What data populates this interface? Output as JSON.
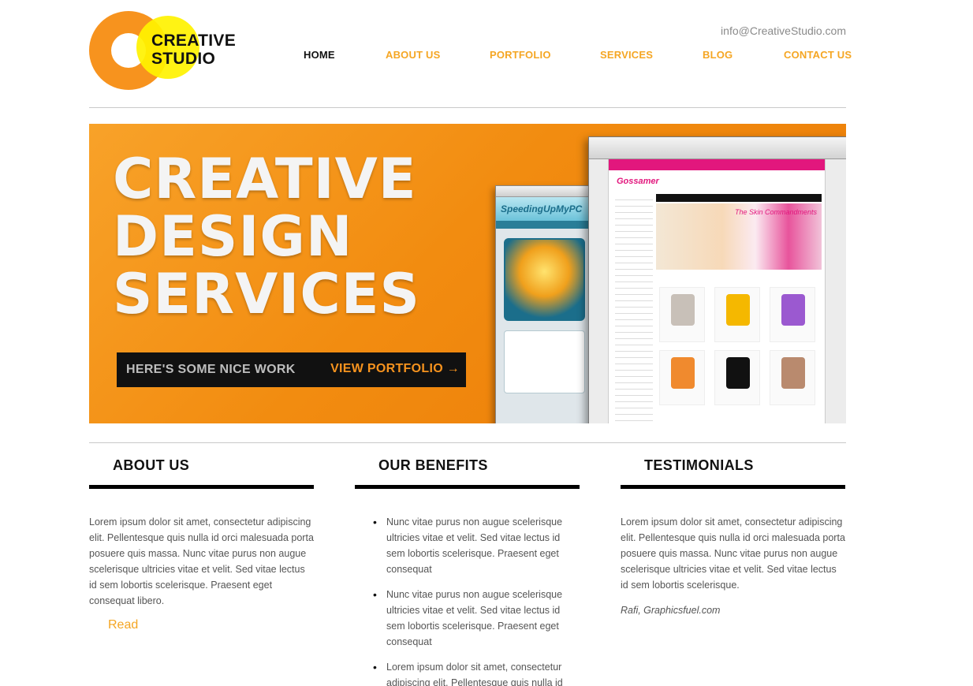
{
  "header": {
    "logo_text_line1": "CREATIVE",
    "logo_text_line2": "STUDIO",
    "email": "info@CreativeStudio.com"
  },
  "nav": {
    "items": [
      {
        "label": "HOME",
        "active": true
      },
      {
        "label": "ABOUT US",
        "active": false
      },
      {
        "label": "PORTFOLIO",
        "active": false
      },
      {
        "label": "SERVICES",
        "active": false
      },
      {
        "label": "BLOG",
        "active": false
      },
      {
        "label": "CONTACT US",
        "active": false
      }
    ]
  },
  "hero": {
    "headline": [
      "CREATIVE",
      "DESIGN",
      "SERVICES"
    ],
    "tagline": "HERE'S SOME NICE WORK",
    "cta_label": "VIEW PORTFOLIO →",
    "mock_small_title": "SpeedingUpMyPC",
    "mock_big_brand": "Gossamer",
    "mock_big_banner": "The Skin Commandments"
  },
  "columns": {
    "about": {
      "title": "ABOUT US",
      "body": "Lorem ipsum dolor sit amet, consectetur adipiscing elit. Pellentesque quis nulla id orci malesuada porta posuere quis massa. Nunc vitae purus non augue scelerisque ultricies vitae et velit. Sed vitae lectus id sem lobortis scelerisque. Praesent eget consequat libero.",
      "read_label": "Read"
    },
    "benefits": {
      "title": "OUR BENEFITS",
      "items": [
        "Nunc vitae purus non augue scelerisque ultricies vitae et velit. Sed vitae lectus id sem lobortis scelerisque. Praesent eget consequat",
        "Nunc vitae purus non augue scelerisque ultricies vitae et velit. Sed vitae lectus id sem lobortis scelerisque. Praesent eget consequat",
        "Lorem ipsum dolor sit amet, consectetur adipiscing elit. Pellentesque quis nulla id orci malesuada porta posuere quis massa."
      ]
    },
    "testimonials": {
      "title": "TESTIMONIALS",
      "body": "Lorem ipsum dolor sit amet, consectetur adipiscing elit. Pellentesque quis nulla id orci malesuada porta posuere quis massa. Nunc vitae purus non augue scelerisque ultricies vitae et velit. Sed vitae lectus id sem lobortis scelerisque.",
      "author": "Rafi, Graphicsfuel.com"
    }
  },
  "colors": {
    "accent": "#f5a623",
    "hero_orange": "#f28c10",
    "logo_yellow": "#fff200",
    "text_dark": "#111111"
  }
}
